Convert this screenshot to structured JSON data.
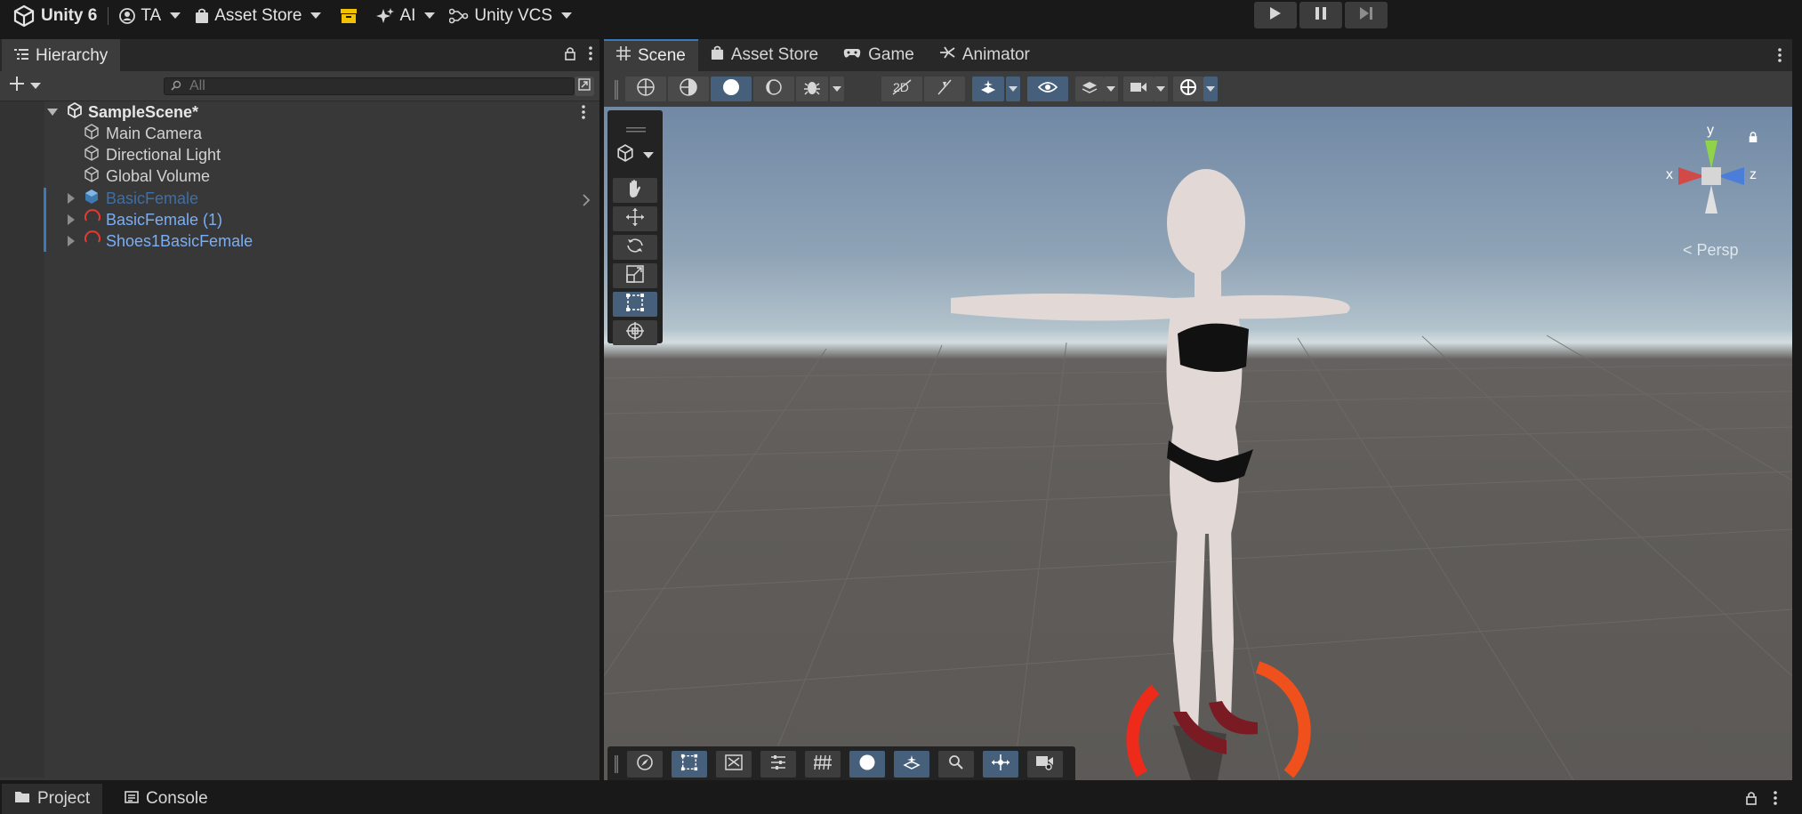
{
  "topbar": {
    "app_title": "Unity 6",
    "account": "TA",
    "asset_store": "Asset Store",
    "ai": "AI",
    "vcs": "Unity VCS"
  },
  "hierarchy": {
    "tab_label": "Hierarchy",
    "search_placeholder": "All",
    "scene_name": "SampleScene*",
    "items": [
      {
        "label": "Main Camera",
        "icon": "gameobject-icon"
      },
      {
        "label": "Directional Light",
        "icon": "gameobject-icon"
      },
      {
        "label": "Global Volume",
        "icon": "gameobject-icon"
      },
      {
        "label": "BasicFemale",
        "icon": "prefab-icon"
      },
      {
        "label": "BasicFemale (1)",
        "icon": "missing-prefab-icon"
      },
      {
        "label": "Shoes1BasicFemale",
        "icon": "missing-prefab-icon"
      }
    ]
  },
  "scene_tabs": [
    {
      "label": "Scene",
      "icon": "grid-icon"
    },
    {
      "label": "Asset Store",
      "icon": "bag-icon"
    },
    {
      "label": "Game",
      "icon": "gamepad-icon"
    },
    {
      "label": "Animator",
      "icon": "animator-icon"
    }
  ],
  "viewport": {
    "projection_label": "Persp",
    "axis_labels": {
      "y": "y",
      "x": "x",
      "z": "z"
    }
  },
  "bottom_tabs": [
    {
      "label": "Project",
      "icon": "folder-icon"
    },
    {
      "label": "Console",
      "icon": "console-icon"
    }
  ],
  "colors": {
    "accent": "#3a79bb",
    "toggle_on": "#46607c",
    "prefab_text": "#7aaef5"
  }
}
